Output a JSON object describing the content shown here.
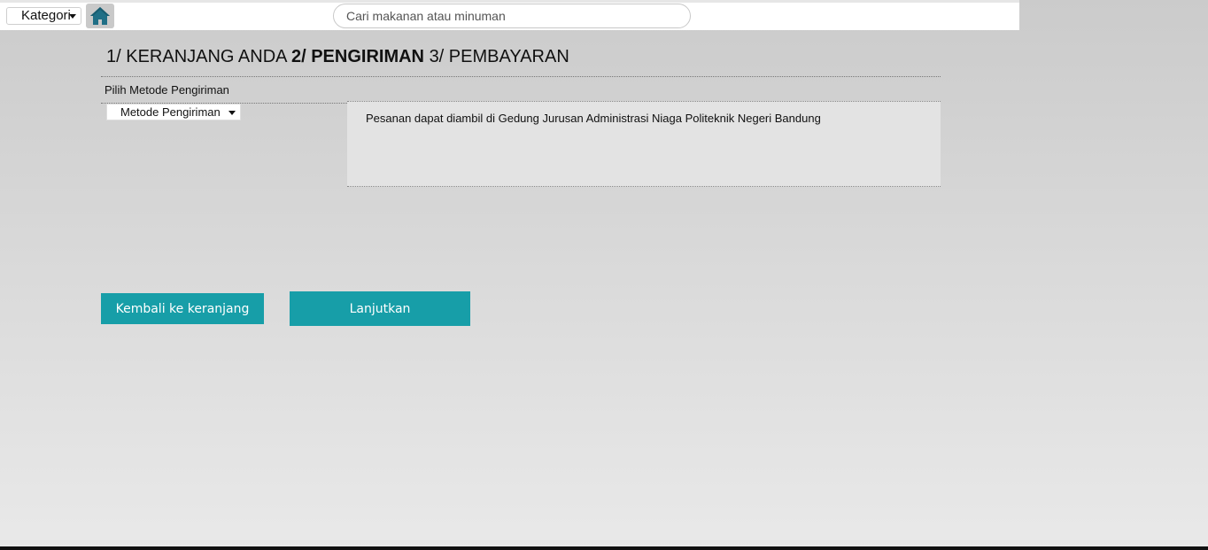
{
  "header": {
    "category_label": "Kategori",
    "search_placeholder": "Cari makanan atau minuman"
  },
  "steps": {
    "step1": "1/ KERANJANG ANDA",
    "step2": "2/ PENGIRIMAN",
    "step3": "3/ PEMBAYARAN"
  },
  "shipping": {
    "section_label": "Pilih Metode Pengiriman",
    "method_select": "Metode Pengiriman",
    "info_text": "Pesanan dapat diambil di Gedung Jurusan Administrasi Niaga Politeknik Negeri Bandung"
  },
  "actions": {
    "back_label": "Kembali ke keranjang",
    "continue_label": "Lanjutkan"
  },
  "colors": {
    "accent": "#179ea8",
    "home_icon": "#1f6f86"
  }
}
